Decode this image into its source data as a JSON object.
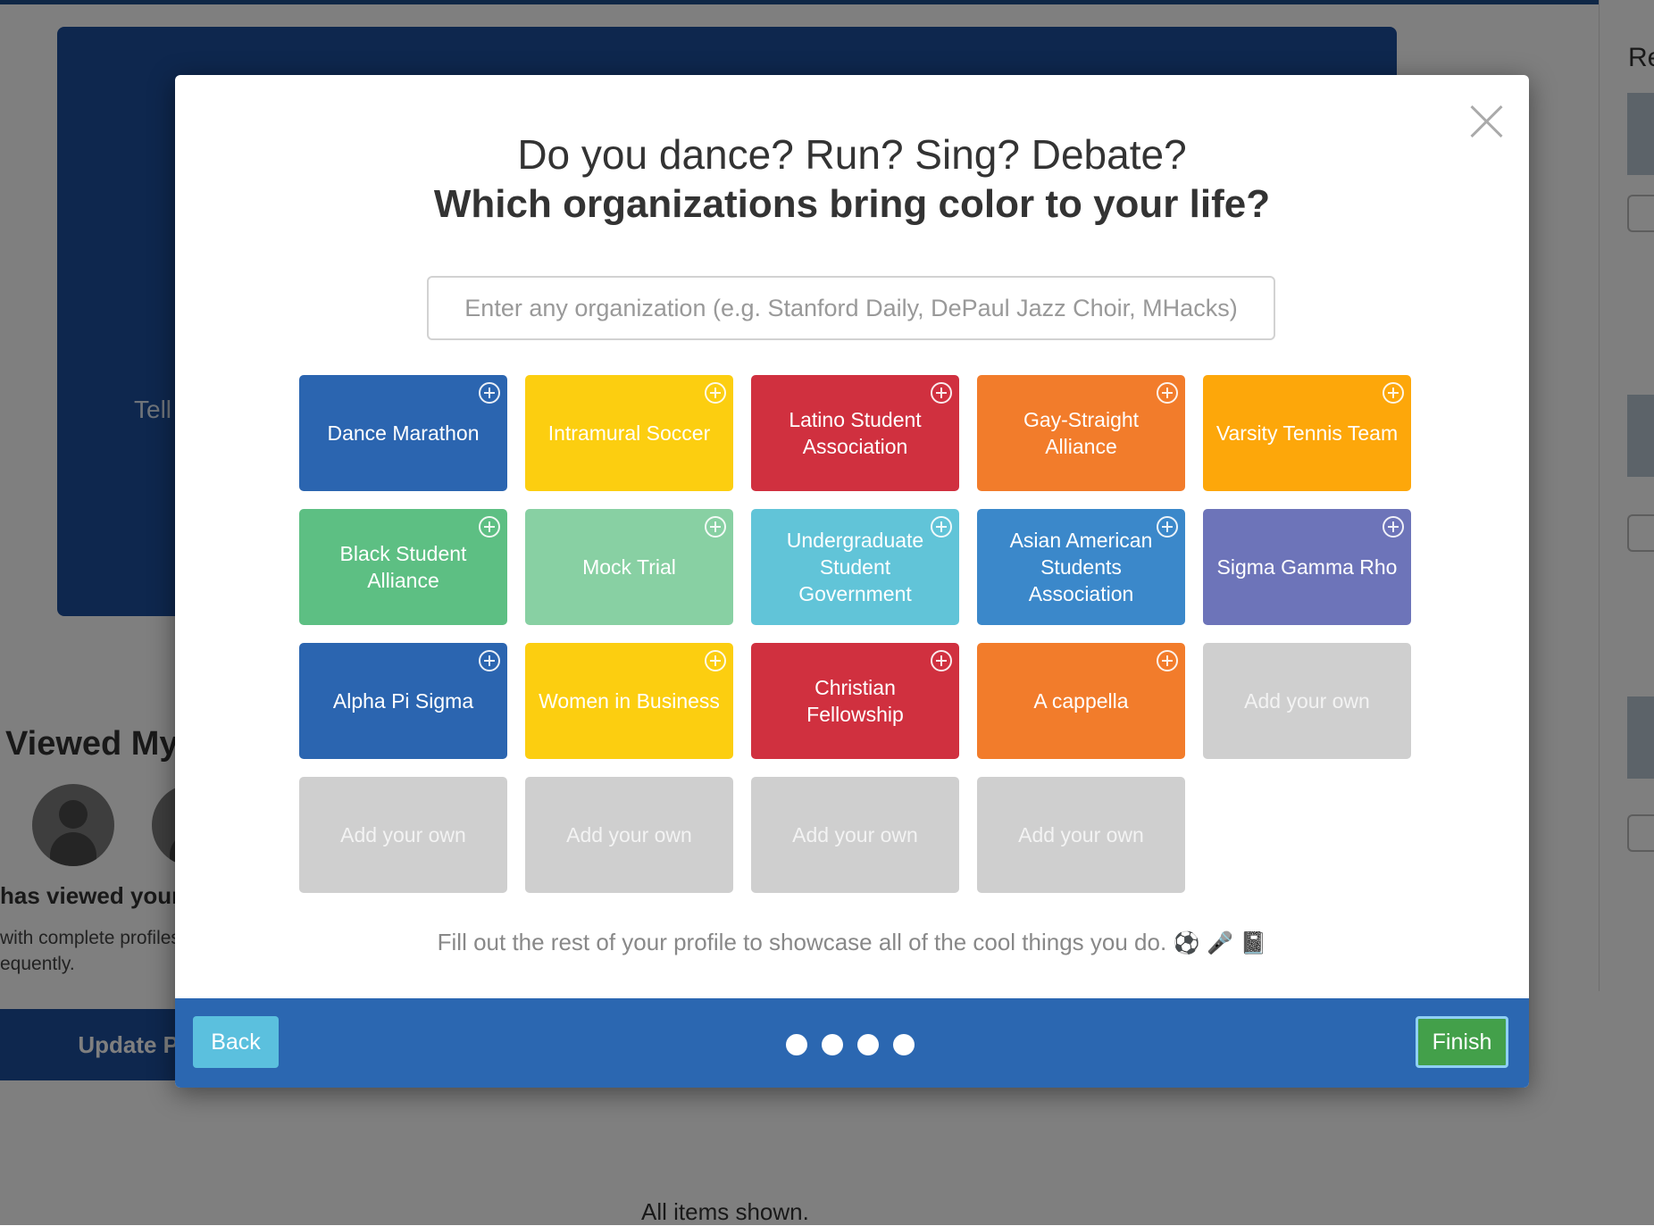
{
  "background": {
    "banner_text": "Tell",
    "viewed_title": "Viewed My P",
    "viewed_text": "has viewed your p",
    "note_line1": "with complete profiles",
    "note_line2": "equently.",
    "update_button": "Update P",
    "right_label": "Re",
    "footer": "All items shown."
  },
  "modal": {
    "title_line1": "Do you dance? Run? Sing? Debate?",
    "title_line2": "Which organizations bring color to your life?",
    "search_placeholder": "Enter any organization (e.g. Stanford Daily, DePaul Jazz Choir, MHacks)",
    "tiles": [
      {
        "label": "Dance Marathon",
        "color": "#2b65b0",
        "addable": true
      },
      {
        "label": "Intramural Soccer",
        "color": "#fcce10",
        "addable": true
      },
      {
        "label": "Latino Student Association",
        "color": "#d0303f",
        "addable": true
      },
      {
        "label": "Gay-Straight Alliance",
        "color": "#f27c2b",
        "addable": true
      },
      {
        "label": "Varsity Tennis Team",
        "color": "#fda70a",
        "addable": true
      },
      {
        "label": "Black Student Alliance",
        "color": "#5dbf83",
        "addable": true
      },
      {
        "label": "Mock Trial",
        "color": "#88d0a3",
        "addable": true
      },
      {
        "label": "Undergraduate Student Government",
        "color": "#61c4d8",
        "addable": true
      },
      {
        "label": "Asian American Students Association",
        "color": "#3b88ca",
        "addable": true
      },
      {
        "label": "Sigma Gamma Rho",
        "color": "#6d74b9",
        "addable": true
      },
      {
        "label": "Alpha Pi Sigma",
        "color": "#2b65b0",
        "addable": true
      },
      {
        "label": "Women in Business",
        "color": "#fcce10",
        "addable": true
      },
      {
        "label": "Christian Fellowship",
        "color": "#d0303f",
        "addable": true
      },
      {
        "label": "A cappella",
        "color": "#f27c2b",
        "addable": true
      },
      {
        "label": "Add your own",
        "color": "#cfcfcf",
        "addable": false
      },
      {
        "label": "Add your own",
        "color": "#cfcfcf",
        "addable": false
      },
      {
        "label": "Add your own",
        "color": "#cfcfcf",
        "addable": false
      },
      {
        "label": "Add your own",
        "color": "#cfcfcf",
        "addable": false
      },
      {
        "label": "Add your own",
        "color": "#cfcfcf",
        "addable": false
      }
    ],
    "footer_text": "Fill out the rest of your profile to showcase all of the cool things you do.",
    "footer_emojis": "⚽ 🎤 📓",
    "back_label": "Back",
    "finish_label": "Finish",
    "step_dots": 4
  }
}
